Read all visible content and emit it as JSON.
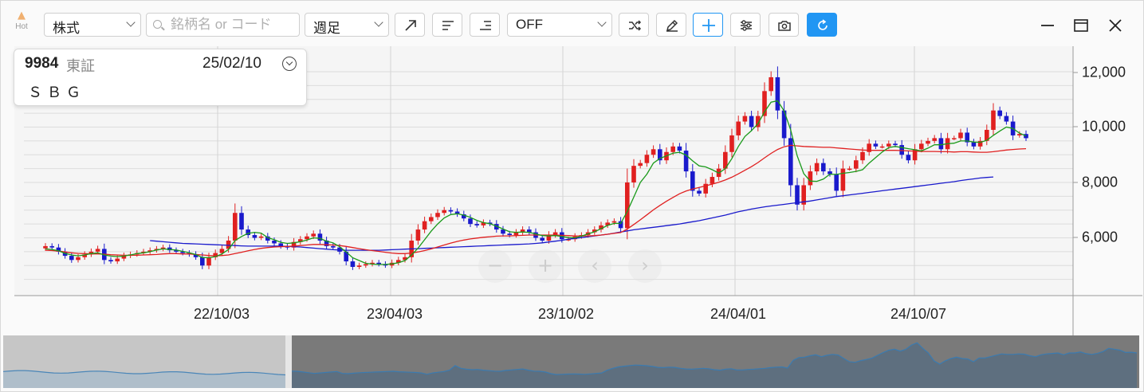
{
  "toolbar": {
    "hot_label": "Hot",
    "market_select": "株式",
    "search_placeholder": "銘柄名 or コード",
    "period_select": "週足",
    "indicator_select": "OFF",
    "accent_color": "#2196f3"
  },
  "popup": {
    "code": "9984",
    "exchange": "東証",
    "date": "25/02/10",
    "name": "ＳＢＧ"
  },
  "chart_data": {
    "type": "candlestick",
    "x_tick_labels": [
      "22/10/03",
      "23/04/03",
      "23/10/02",
      "24/04/01",
      "24/10/07"
    ],
    "y_tick_labels": [
      "6,000",
      "8,000",
      "10,000",
      "12,000"
    ],
    "ylim": [
      4000,
      12800
    ],
    "up_color": "#e02020",
    "down_color": "#1a1acc",
    "ma_short_color": "#1a9a1a",
    "ma_mid_color": "#e02020",
    "ma_long_color": "#1a1acc",
    "grid": true,
    "closes": [
      5700,
      5650,
      5500,
      5350,
      5200,
      5300,
      5400,
      5500,
      5600,
      5200,
      5150,
      5250,
      5350,
      5400,
      5450,
      5500,
      5550,
      5600,
      5650,
      5550,
      5500,
      5450,
      5400,
      5300,
      5000,
      5300,
      5450,
      5600,
      5900,
      6900,
      6300,
      6100,
      6000,
      6050,
      5900,
      5800,
      5700,
      5650,
      5850,
      5950,
      6050,
      6150,
      5900,
      5700,
      5650,
      5500,
      5150,
      4950,
      5000,
      5050,
      5100,
      5050,
      5000,
      5100,
      5200,
      5300,
      5900,
      6300,
      6600,
      6750,
      6900,
      7000,
      6950,
      6850,
      6700,
      6500,
      6450,
      6550,
      6500,
      6300,
      6150,
      6100,
      6200,
      6300,
      6200,
      6000,
      5900,
      6100,
      6200,
      5950,
      5950,
      6050,
      6100,
      6200,
      6300,
      6450,
      6550,
      6600,
      6350,
      8000,
      8600,
      8700,
      9000,
      9200,
      8800,
      9100,
      9300,
      9150,
      8400,
      7700,
      7600,
      7950,
      8200,
      8500,
      9100,
      9700,
      10200,
      10400,
      10000,
      10400,
      11300,
      11800,
      10600,
      9600,
      7900,
      7200,
      7900,
      8400,
      8700,
      8400,
      8300,
      7700,
      8500,
      8500,
      8800,
      9100,
      9400,
      9300,
      9300,
      9400,
      9350,
      9000,
      8800,
      9200,
      9400,
      9500,
      9600,
      9200,
      9600,
      9600,
      9800,
      9450,
      9300,
      9500,
      9900,
      10600,
      10400,
      10200,
      9700,
      9750,
      9600
    ],
    "ma_short": [
      5600,
      5580,
      5530,
      5440,
      5380,
      5350,
      5380,
      5430,
      5460,
      5380,
      5340,
      5320,
      5340,
      5380,
      5430,
      5460,
      5500,
      5560,
      5600,
      5580,
      5560,
      5510,
      5460,
      5400,
      5290,
      5280,
      5320,
      5420,
      5580,
      5900,
      6050,
      6160,
      6200,
      6170,
      6010,
      5930,
      5840,
      5800,
      5820,
      5860,
      5920,
      6000,
      5980,
      5880,
      5820,
      5680,
      5490,
      5280,
      5180,
      5080,
      5050,
      5040,
      5040,
      5060,
      5100,
      5180,
      5380,
      5630,
      5930,
      6240,
      6500,
      6720,
      6840,
      6870,
      6820,
      6740,
      6630,
      6550,
      6510,
      6420,
      6320,
      6220,
      6200,
      6210,
      6200,
      6140,
      6080,
      6070,
      6080,
      6050,
      6010,
      6000,
      6060,
      6140,
      6220,
      6330,
      6450,
      6520,
      6520,
      6950,
      7470,
      8000,
      8300,
      8700,
      8870,
      8960,
      9060,
      9090,
      8990,
      8780,
      8600,
      8560,
      8460,
      8340,
      8500,
      8860,
      9300,
      9660,
      9870,
      10120,
      10550,
      10900,
      10950,
      10580,
      9900,
      8960,
      8320,
      8050,
      8040,
      8120,
      8300,
      8290,
      8330,
      8360,
      8400,
      8460,
      8700,
      8900,
      9100,
      9260,
      9300,
      9260,
      9220,
      9180,
      9140,
      9240,
      9360,
      9360,
      9400,
      9420,
      9500,
      9500,
      9460,
      9450,
      9520,
      9700,
      9860,
      10000,
      9950,
      9780,
      9680
    ],
    "ma_mid": [
      5550,
      5540,
      5520,
      5490,
      5460,
      5440,
      5430,
      5420,
      5420,
      5410,
      5390,
      5380,
      5370,
      5370,
      5370,
      5380,
      5390,
      5400,
      5420,
      5430,
      5430,
      5420,
      5420,
      5400,
      5380,
      5360,
      5350,
      5360,
      5380,
      5430,
      5480,
      5530,
      5580,
      5620,
      5650,
      5670,
      5680,
      5690,
      5700,
      5720,
      5740,
      5760,
      5760,
      5750,
      5740,
      5720,
      5690,
      5650,
      5610,
      5570,
      5540,
      5510,
      5480,
      5450,
      5430,
      5430,
      5450,
      5490,
      5540,
      5600,
      5670,
      5740,
      5810,
      5870,
      5920,
      5960,
      5990,
      6020,
      6040,
      6060,
      6070,
      6070,
      6080,
      6090,
      6100,
      6100,
      6100,
      6100,
      6100,
      6090,
      6080,
      6070,
      6070,
      6070,
      6080,
      6100,
      6130,
      6160,
      6190,
      6320,
      6480,
      6650,
      6830,
      7010,
      7170,
      7320,
      7460,
      7590,
      7690,
      7760,
      7820,
      7880,
      7940,
      8010,
      8090,
      8190,
      8310,
      8440,
      8570,
      8720,
      8890,
      9050,
      9190,
      9290,
      9340,
      9320,
      9300,
      9290,
      9280,
      9270,
      9270,
      9250,
      9230,
      9210,
      9190,
      9170,
      9160,
      9160,
      9160,
      9160,
      9160,
      9150,
      9140,
      9130,
      9120,
      9120,
      9120,
      9110,
      9110,
      9100,
      9110,
      9110,
      9100,
      9090,
      9090,
      9110,
      9140,
      9170,
      9190,
      9210,
      9220
    ],
    "ma_long_start": 16,
    "ma_long": [
      5900,
      5880,
      5860,
      5840,
      5820,
      5800,
      5790,
      5780,
      5770,
      5760,
      5750,
      5740,
      5730,
      5720,
      5710,
      5700,
      5700,
      5700,
      5700,
      5700,
      5700,
      5690,
      5680,
      5670,
      5650,
      5630,
      5610,
      5590,
      5570,
      5560,
      5550,
      5550,
      5550,
      5550,
      5550,
      5550,
      5560,
      5570,
      5580,
      5590,
      5600,
      5610,
      5620,
      5630,
      5640,
      5650,
      5660,
      5670,
      5680,
      5690,
      5700,
      5710,
      5720,
      5730,
      5740,
      5750,
      5760,
      5770,
      5780,
      5800,
      5820,
      5850,
      5880,
      5910,
      5950,
      5980,
      6010,
      6040,
      6070,
      6100,
      6130,
      6170,
      6210,
      6250,
      6290,
      6320,
      6350,
      6380,
      6410,
      6440,
      6470,
      6500,
      6540,
      6580,
      6620,
      6670,
      6720,
      6770,
      6820,
      6880,
      6940,
      6990,
      7040,
      7080,
      7120,
      7150,
      7180,
      7210,
      7240,
      7270,
      7300,
      7330,
      7370,
      7410,
      7450,
      7490,
      7520,
      7550,
      7580,
      7610,
      7640,
      7670,
      7700,
      7730,
      7760,
      7790,
      7820,
      7850,
      7880,
      7910,
      7940,
      7970,
      8000,
      8030,
      8070,
      8100,
      8130,
      8160,
      8180,
      8200
    ]
  }
}
